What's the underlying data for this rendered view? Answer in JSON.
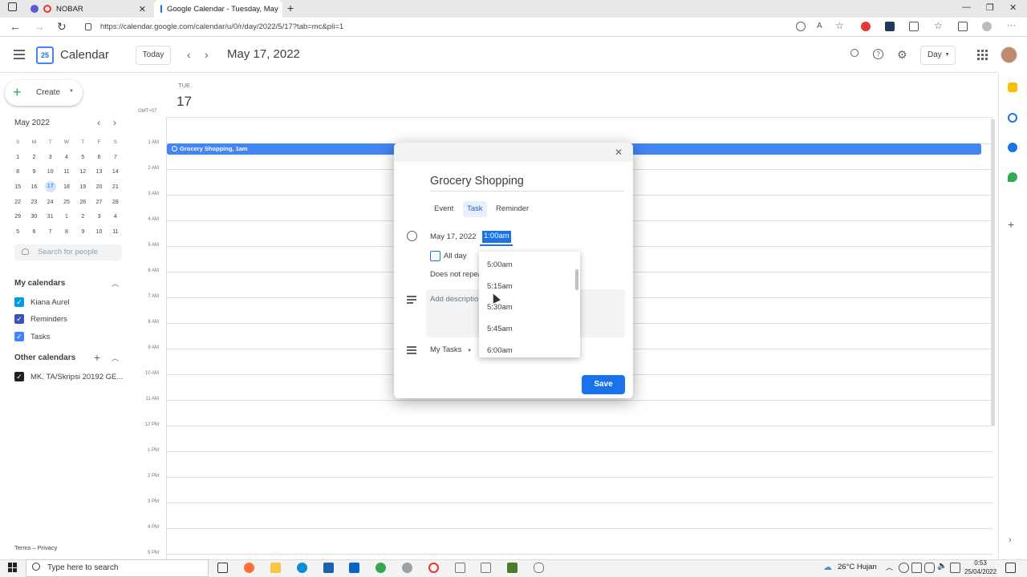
{
  "browser": {
    "tabs": [
      {
        "label": "NOBAR"
      },
      {
        "label": "Google Calendar - Tuesday, May"
      }
    ],
    "url": "https://calendar.google.com/calendar/u/0/r/day/2022/5/17?tab=mc&pli=1"
  },
  "header": {
    "app_title": "Calendar",
    "logo_text": "25",
    "today_label": "Today",
    "date_title": "May 17, 2022",
    "view_label": "Day"
  },
  "sidebar": {
    "create_label": "Create",
    "mini_month": "May 2022",
    "mini_dows": [
      "S",
      "M",
      "T",
      "W",
      "T",
      "F",
      "S"
    ],
    "mini_weeks": [
      [
        "1",
        "2",
        "3",
        "4",
        "5",
        "6",
        "7"
      ],
      [
        "8",
        "9",
        "10",
        "11",
        "12",
        "13",
        "14"
      ],
      [
        "15",
        "16",
        "17",
        "18",
        "19",
        "20",
        "21"
      ],
      [
        "22",
        "23",
        "24",
        "25",
        "26",
        "27",
        "28"
      ],
      [
        "29",
        "30",
        "31",
        "1",
        "2",
        "3",
        "4"
      ],
      [
        "5",
        "6",
        "7",
        "8",
        "9",
        "10",
        "11"
      ]
    ],
    "selected_day": "17",
    "people_search_placeholder": "Search for people",
    "my_calendars_title": "My calendars",
    "my_calendars": [
      {
        "label": "Kiana Aurel",
        "color": "#039be5"
      },
      {
        "label": "Reminders",
        "color": "#3f51b5"
      },
      {
        "label": "Tasks",
        "color": "#4285f4"
      }
    ],
    "other_calendars_title": "Other calendars",
    "other_calendars": [
      {
        "label": "MK. TA/Skripsi 20192 GE...",
        "color": "#202124"
      }
    ],
    "footer": "Terms – Privacy"
  },
  "day_view": {
    "dow": "TUE",
    "day_num": "17",
    "timezone": "GMT+07",
    "hours": [
      "1 AM",
      "2 AM",
      "3 AM",
      "4 AM",
      "5 AM",
      "6 AM",
      "7 AM",
      "8 AM",
      "9 AM",
      "10 AM",
      "11 AM",
      "12 PM",
      "1 PM",
      "2 PM",
      "3 PM",
      "4 PM",
      "5 PM"
    ],
    "event_label": "Grocery Shopping, 1am"
  },
  "dialog": {
    "title": "Grocery Shopping",
    "tabs": [
      "Event",
      "Task",
      "Reminder"
    ],
    "active_tab": "Task",
    "date": "May 17, 2022",
    "time": "1:00am",
    "all_day_label": "All day",
    "repeat_label": "Does not repea",
    "description_placeholder": "Add descriptio",
    "task_list": "My Tasks",
    "save_label": "Save",
    "time_options": [
      "5:00am",
      "5:15am",
      "5:30am",
      "5:45am",
      "6:00am"
    ]
  },
  "taskbar": {
    "search_placeholder": "Type here to search",
    "weather": "26°C  Hujan",
    "time": "0:53",
    "date": "25/04/2022"
  }
}
